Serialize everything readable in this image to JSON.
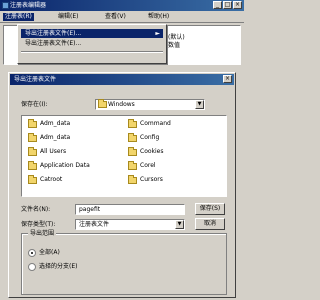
{
  "app": {
    "title": "注册表编辑器",
    "menus": [
      "注册表(R)",
      "编辑(E)",
      "查看(V)",
      "帮助(H)"
    ]
  },
  "dropdown": {
    "items": [
      "导出注册表文件(E)...",
      "导出注册表文件(E)..."
    ],
    "arrow": "►"
  },
  "list_fragment": [
    "(默认)",
    "数值"
  ],
  "dialog": {
    "title": "导出注册表文件",
    "close": "×",
    "save_in_label": "保存在(I):",
    "save_in_value": "Windows",
    "folders": [
      "Adm_data",
      "Command",
      "Adm_data",
      "Config",
      "All Users",
      "Cookies",
      "Application Data",
      "Corel",
      "Catroot",
      "Cursors"
    ],
    "filename_label": "文件名(N):",
    "filename_value": "pagefit",
    "filetype_label": "保存类型(T):",
    "filetype_value": "注册表文件",
    "save_button": "保存(S)",
    "cancel_button": "取消",
    "export_range_title": "导出范围",
    "range_all": "全部(A)",
    "range_selected": "选择的分支(E)"
  },
  "colors": {
    "titlebar": "#0a246a",
    "face": "#d4d0c8",
    "folder": "#f2d56b"
  }
}
